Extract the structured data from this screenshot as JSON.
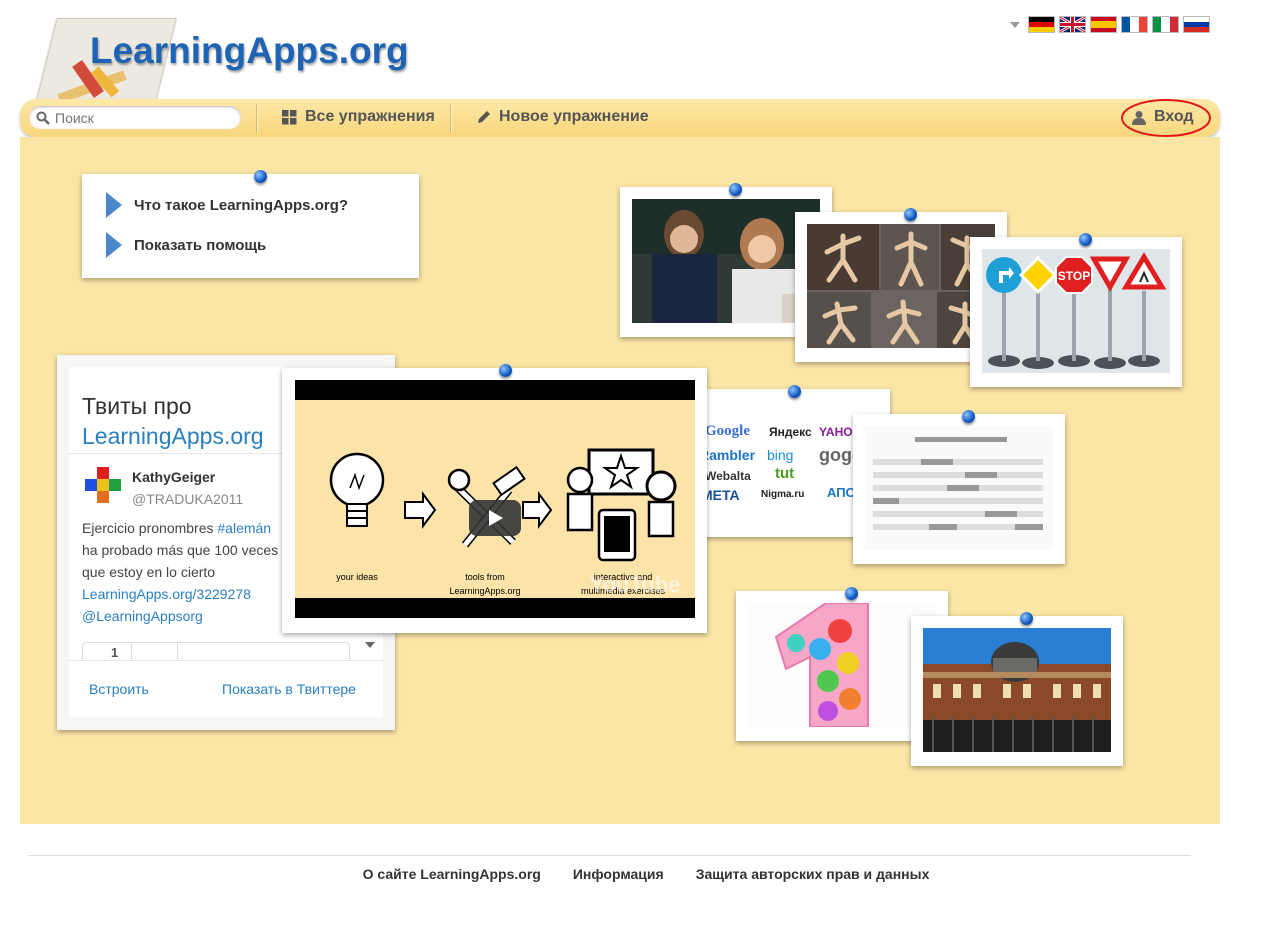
{
  "header": {
    "logo_text": "LearningApps.org"
  },
  "flags": [
    {
      "name": "german-flag",
      "colors": [
        "#000000",
        "#dd0000",
        "#ffce00"
      ]
    },
    {
      "name": "english-flag",
      "colors": [
        "#012169",
        "#ffffff",
        "#c8102e"
      ]
    },
    {
      "name": "spanish-flag",
      "colors": [
        "#c60b1e",
        "#ffc400",
        "#c60b1e"
      ]
    },
    {
      "name": "french-flag",
      "colors": [
        "#0055a4",
        "#ffffff",
        "#ef4135"
      ]
    },
    {
      "name": "italian-flag",
      "colors": [
        "#009246",
        "#ffffff",
        "#ce2b37"
      ]
    },
    {
      "name": "russian-flag",
      "colors": [
        "#ffffff",
        "#0039a6",
        "#d52b1e"
      ]
    }
  ],
  "navbar": {
    "search_placeholder": "Поиск",
    "all_exercises": "Все упражнения",
    "new_exercise": "Новое упражнение",
    "login": "Вход"
  },
  "info": {
    "what_is": "Что такое LearningApps.org?",
    "show_help": "Показать помощь"
  },
  "twitter": {
    "title_line1": "Твиты про",
    "title_line2": "LearningApps.org",
    "user_name": "KathyGeiger",
    "user_handle": "@TRADUKA2011",
    "tweet_line1": "Ejercicio pronombres",
    "tweet_hashtag": "#alemán",
    "tweet_line2": "ha probado más que 100 veces",
    "tweet_line3": "que estoy en lo cierto",
    "tweet_link": "LearningApps.org/3229278",
    "tweet_mention": "@LearningAppsorg",
    "counter": "1",
    "embed": "Встроить",
    "show_in_twitter": "Показать в Твиттере"
  },
  "video": {
    "label_ideas": "your ideas",
    "label_tools_1": "tools from",
    "label_tools_2": "LearningApps.org",
    "label_exercises_1": "interactive and",
    "label_exercises_2": "multimedia exercises",
    "watermark": "YouTube"
  },
  "search_engines": [
    "Google",
    "Яндекс",
    "YAHOO",
    "Rambler",
    "bing",
    "gogo",
    "Webalta",
    "tut",
    "META",
    "Nigma.ru",
    "АПОРТ"
  ],
  "signs": {
    "stop": "STOP"
  },
  "footer": {
    "about": "О сайте LearningApps.org",
    "info": "Информация",
    "privacy": "Защита авторских прав и данных"
  },
  "colors": {
    "board": "#fbe6a6",
    "accent_blue": "#1f63b5",
    "link_blue": "#2a7fc0"
  }
}
